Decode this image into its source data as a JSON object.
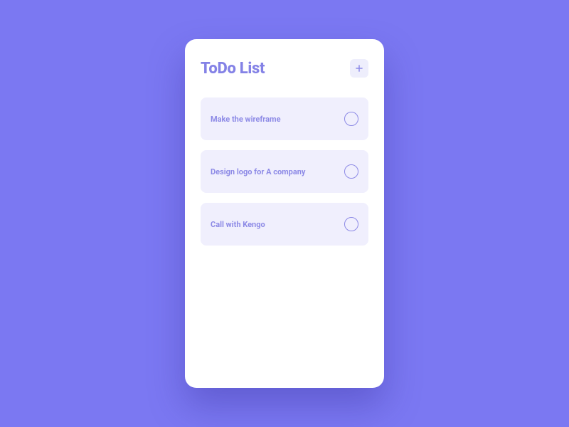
{
  "header": {
    "title": "ToDo List"
  },
  "todos": [
    {
      "label": "Make the wireframe"
    },
    {
      "label": "Design logo for A company"
    },
    {
      "label": "Call with Kengo"
    }
  ]
}
